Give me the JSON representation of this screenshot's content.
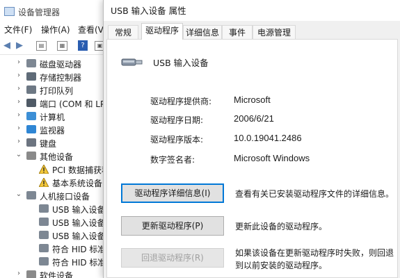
{
  "device_manager": {
    "title": "设备管理器",
    "menu": [
      "文件(F)",
      "操作(A)",
      "查看(V"
    ],
    "tree": [
      {
        "label": "磁盘驱动器",
        "expanded": false,
        "indent": 0,
        "icon": "disk-icon"
      },
      {
        "label": "存储控制器",
        "expanded": false,
        "indent": 0,
        "icon": "storage-controller-icon"
      },
      {
        "label": "打印队列",
        "expanded": false,
        "indent": 0,
        "icon": "printer-icon"
      },
      {
        "label": "端口 (COM 和 LP",
        "expanded": false,
        "indent": 0,
        "icon": "port-icon"
      },
      {
        "label": "计算机",
        "expanded": false,
        "indent": 0,
        "icon": "computer-icon"
      },
      {
        "label": "监视器",
        "expanded": false,
        "indent": 0,
        "icon": "monitor-icon"
      },
      {
        "label": "键盘",
        "expanded": false,
        "indent": 0,
        "icon": "keyboard-icon"
      },
      {
        "label": "其他设备",
        "expanded": true,
        "indent": 0,
        "icon": "other-devices-icon"
      },
      {
        "label": "PCI 数据捕获和",
        "expanded": null,
        "indent": 1,
        "icon": "warning-icon"
      },
      {
        "label": "基本系统设备",
        "expanded": null,
        "indent": 1,
        "icon": "warning-icon"
      },
      {
        "label": "人机接口设备",
        "expanded": true,
        "indent": 0,
        "icon": "hid-icon"
      },
      {
        "label": "USB 输入设备",
        "expanded": null,
        "indent": 1,
        "icon": "hid-device-icon"
      },
      {
        "label": "USB 输入设备",
        "expanded": null,
        "indent": 1,
        "icon": "hid-device-icon"
      },
      {
        "label": "USB 输入设备",
        "expanded": null,
        "indent": 1,
        "icon": "hid-device-icon"
      },
      {
        "label": "符合 HID 标准",
        "expanded": null,
        "indent": 1,
        "icon": "hid-device-icon"
      },
      {
        "label": "符合 HID 标准",
        "expanded": null,
        "indent": 1,
        "icon": "hid-device-icon"
      },
      {
        "label": "软件设备",
        "expanded": false,
        "indent": 0,
        "icon": "software-device-icon"
      }
    ]
  },
  "dialog": {
    "title": "USB 输入设备 属性",
    "tabs": [
      "常规",
      "驱动程序",
      "详细信息",
      "事件",
      "电源管理"
    ],
    "active_tab": "驱动程序",
    "device_name": "USB 输入设备",
    "info": [
      {
        "label": "驱动程序提供商:",
        "value": "Microsoft"
      },
      {
        "label": "驱动程序日期:",
        "value": "2006/6/21"
      },
      {
        "label": "驱动程序版本:",
        "value": "10.0.19041.2486"
      },
      {
        "label": "数字签名者:",
        "value": "Microsoft Windows"
      }
    ],
    "buttons": [
      {
        "label": "驱动程序详细信息(I)",
        "description": "查看有关已安装驱动程序文件的详细信息。",
        "enabled": true,
        "focused": true
      },
      {
        "label": "更新驱动程序(P)",
        "description": "更新此设备的驱动程序。",
        "enabled": true,
        "focused": false
      },
      {
        "label": "回退驱动程序(R)",
        "description": "如果该设备在更新驱动程序时失败，则回退到以前安装的驱动程序。",
        "enabled": false,
        "focused": false
      }
    ]
  }
}
